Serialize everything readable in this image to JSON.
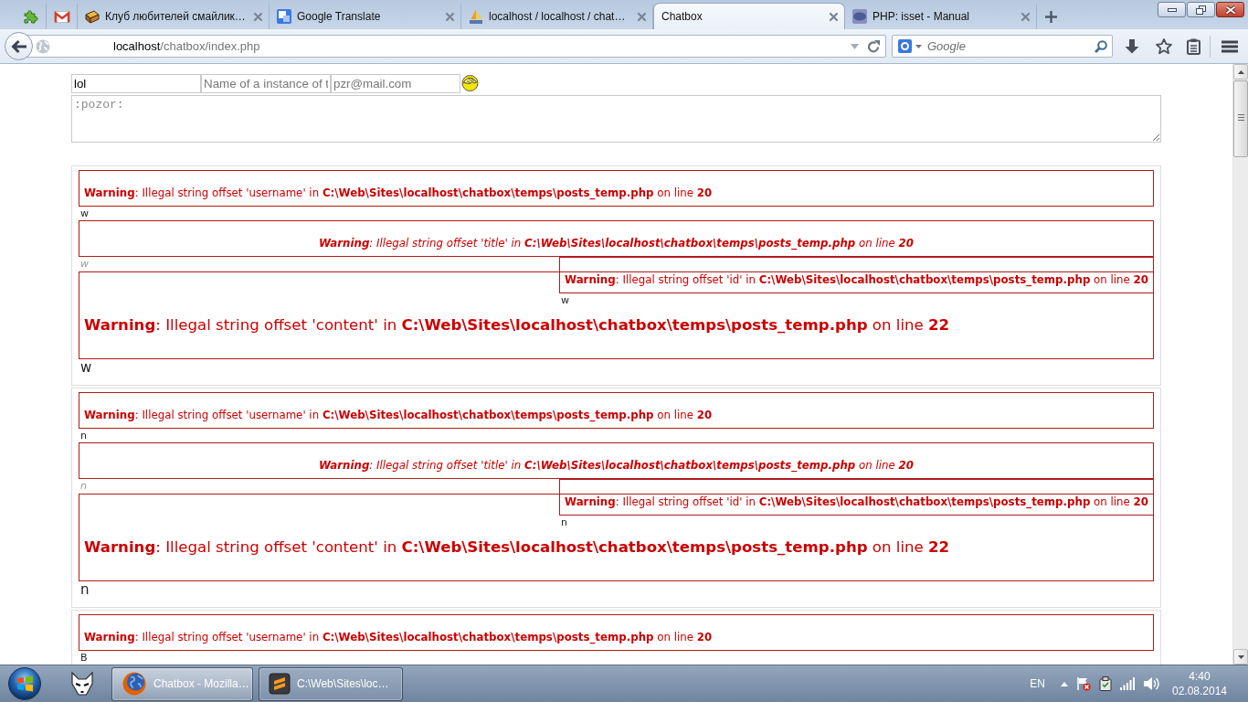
{
  "browser": {
    "tabs": [
      {
        "title": "Клуб любителей смайлик…",
        "selected": false
      },
      {
        "title": "Google Translate",
        "selected": false
      },
      {
        "title": "localhost / localhost / chat…",
        "selected": false
      },
      {
        "title": "Chatbox",
        "selected": true
      },
      {
        "title": "PHP: isset - Manual",
        "selected": false
      }
    ],
    "address": {
      "host": "localhost",
      "path": "/chatbox/index.php"
    },
    "search": {
      "placeholder": "Google"
    }
  },
  "form": {
    "name": {
      "value": "lol"
    },
    "instance": {
      "placeholder": "Name of a instance of t"
    },
    "email": {
      "placeholder": "pzr@mail.com"
    },
    "message": {
      "placeholder": ":pozor:"
    }
  },
  "posts": [
    {
      "username": {
        "warning": "**Warning**: Illegal string offset 'username' in **C:\\Web\\Sites\\localhost\\chatbox\\temps\\posts_temp.php** on line **20**",
        "value": "w"
      },
      "title": {
        "warning": "**Warning**: Illegal string offset 'title' in **C:\\Web\\Sites\\localhost\\chatbox\\temps\\posts_temp.php** on line **20**",
        "value": "w"
      },
      "id": {
        "warning": "**Warning**: Illegal string offset 'id' in **C:\\Web\\Sites\\localhost\\chatbox\\temps\\posts_temp.php** on line **20**",
        "value": "w"
      },
      "content": {
        "warning": "**Warning**: Illegal string offset 'content' in **C:\\Web\\Sites\\localhost\\chatbox\\temps\\posts_temp.php** on line **22**",
        "value": "w"
      }
    },
    {
      "username": {
        "warning": "**Warning**: Illegal string offset 'username' in **C:\\Web\\Sites\\localhost\\chatbox\\temps\\posts_temp.php** on line **20**",
        "value": "n"
      },
      "title": {
        "warning": "**Warning**: Illegal string offset 'title' in **C:\\Web\\Sites\\localhost\\chatbox\\temps\\posts_temp.php** on line **20**",
        "value": "n"
      },
      "id": {
        "warning": "**Warning**: Illegal string offset 'id' in **C:\\Web\\Sites\\localhost\\chatbox\\temps\\posts_temp.php** on line **20**",
        "value": "n"
      },
      "content": {
        "warning": "**Warning**: Illegal string offset 'content' in **C:\\Web\\Sites\\localhost\\chatbox\\temps\\posts_temp.php** on line **22**",
        "value": "n"
      }
    },
    {
      "username": {
        "warning": "**Warning**: Illegal string offset 'username' in **C:\\Web\\Sites\\localhost\\chatbox\\temps\\posts_temp.php** on line **20**",
        "value": "B"
      }
    }
  ],
  "taskbar": {
    "buttons": [
      {
        "label": "Chatbox - Mozilla…",
        "selected": true
      },
      {
        "label": "C:\\Web\\Sites\\loc…",
        "selected": false
      }
    ],
    "language": "EN",
    "time": "4:40",
    "date": "02.08.2014"
  }
}
